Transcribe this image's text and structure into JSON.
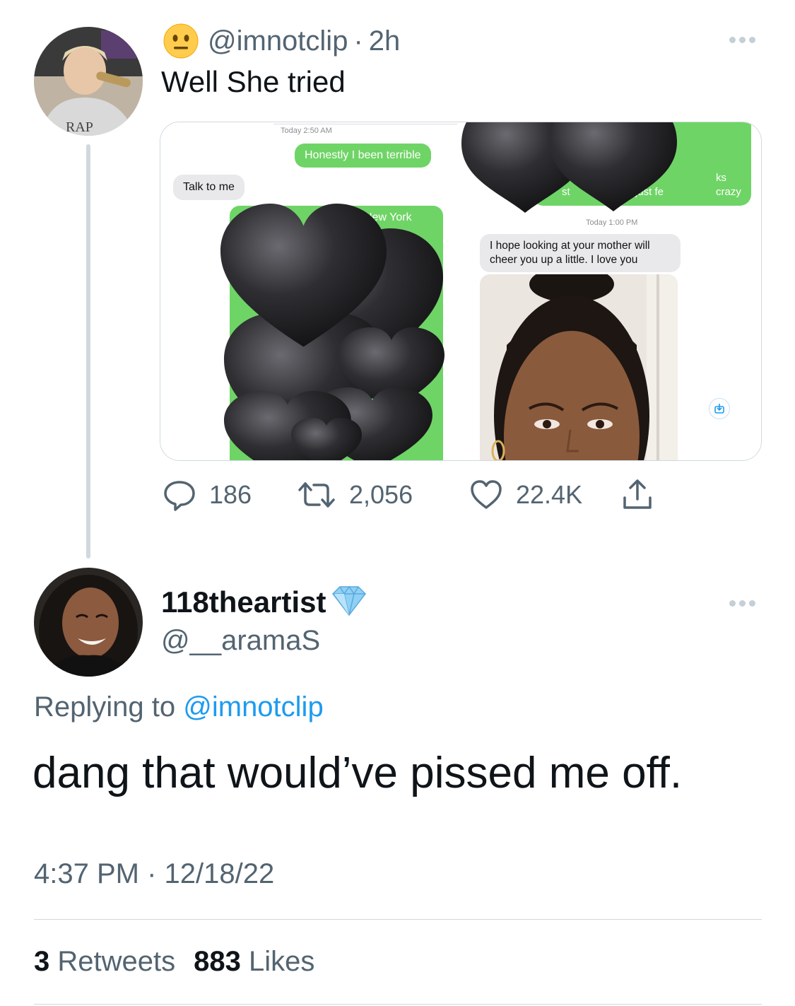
{
  "tweet": {
    "emoji": "neutral-face-emoji",
    "handle": "@imnotclip",
    "separator": "·",
    "time": "2h",
    "text": "Well She tried",
    "media": {
      "left": {
        "timestamp": "Today 2:50 AM",
        "sent_message": "Honestly I been terrible",
        "received_message": "Talk to me",
        "partial_text": "New York"
      },
      "right": {
        "partial_left": "st",
        "partial_mid": "just fe",
        "partial_top": "ks",
        "partial_right": "crazy",
        "timestamp": "Today 1:00 PM",
        "received_message": "I hope looking at your mother will cheer you up a little. I love you"
      }
    },
    "stats": {
      "replies": "186",
      "retweets": "2,056",
      "likes": "22.4K"
    }
  },
  "reply": {
    "display_name": "118theartist",
    "badge": "diamond-emoji",
    "handle": "@__aramaS",
    "replying_prefix": "Replying to",
    "replying_to": "@imnotclip",
    "text": "dang that would’ve pissed me off.",
    "time": "4:37 PM",
    "separator": "·",
    "date": "12/18/22",
    "retweets_count": "3",
    "retweets_label": "Retweets",
    "likes_count": "883",
    "likes_label": "Likes"
  },
  "colors": {
    "accent": "#1d9bf0",
    "imessage_green": "#6fd466",
    "imessage_grey": "#e9e9eb",
    "heart_black": "#2b2b2e"
  }
}
